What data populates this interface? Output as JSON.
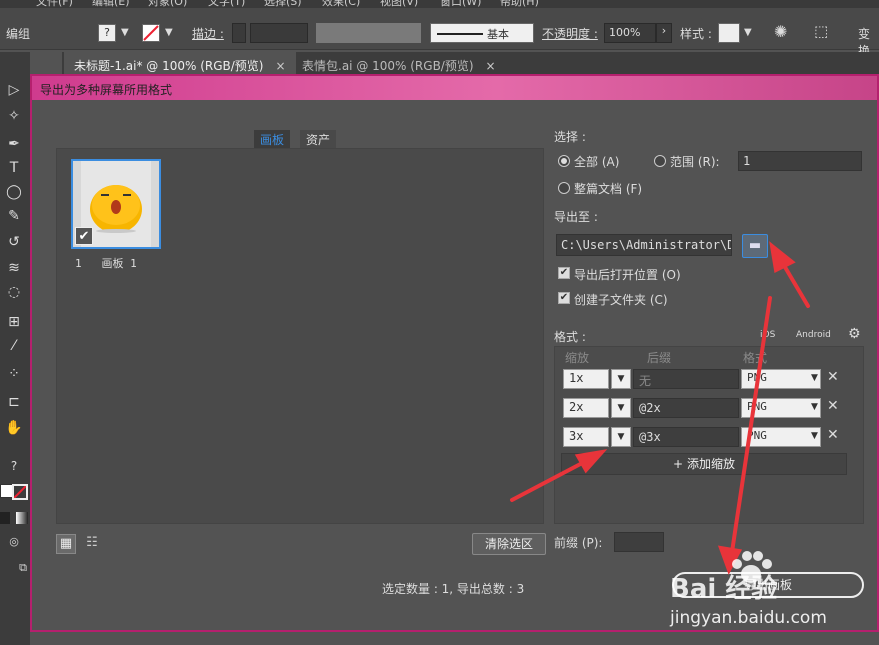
{
  "menubar": [
    "文件(F)",
    "编辑(E)",
    "对象(O)",
    "文字(T)",
    "选择(S)",
    "效果(C)",
    "视图(V)",
    "窗口(W)",
    "帮助(H)"
  ],
  "controlbar": {
    "context": "编组",
    "stroke_label": "描边 :",
    "stroke_style": "基本",
    "opacity_label": "不透明度 :",
    "opacity_value": "100%",
    "style_label": "样式 :",
    "transform_label": "变换"
  },
  "tabs": [
    {
      "label": "未标题-1.ai* @ 100% (RGB/预览)",
      "close": "×"
    },
    {
      "label": "表情包.ai @ 100% (RGB/预览)",
      "close": "×"
    }
  ],
  "toolbar": {
    "help": "?"
  },
  "dialog": {
    "title": "导出为多种屏幕所用格式",
    "view_tabs": [
      "画板",
      "资产"
    ],
    "artboard": {
      "number": "1",
      "name": "画板 1"
    },
    "clear_selection": "清除选区",
    "select_label": "选择 :",
    "option_all": "全部 (A)",
    "option_range": "范围 (R):",
    "range_value": "1",
    "option_whole_doc": "整篇文档 (F)",
    "export_to_label": "导出至 :",
    "export_path": "C:\\Users\\Administrator\\D",
    "open_after_export": "导出后打开位置 (O)",
    "create_subfolders": "创建子文件夹 (C)",
    "formats_label": "格式 :",
    "ios_label": "iOS",
    "android_label": "Android",
    "col_scale": "缩放",
    "col_suffix": "后缀",
    "col_format": "格式",
    "rows": [
      {
        "scale": "1x",
        "suffix": "无",
        "format": "PNG"
      },
      {
        "scale": "2x",
        "suffix": "@2x",
        "format": "PNG"
      },
      {
        "scale": "3x",
        "suffix": "@3x",
        "format": "PNG"
      }
    ],
    "add_scale": "添加缩放",
    "prefix_label": "前缀 (P):",
    "summary": "选定数量 : 1, 导出总数 : 3",
    "export_button": "导出画板"
  },
  "watermark": {
    "brand": "Bai 经验",
    "url": "jingyan.baidu.com"
  },
  "colors": {
    "accent": "#3b8de0",
    "titlebar": "#d6479a",
    "arrow": "#e8343a"
  }
}
